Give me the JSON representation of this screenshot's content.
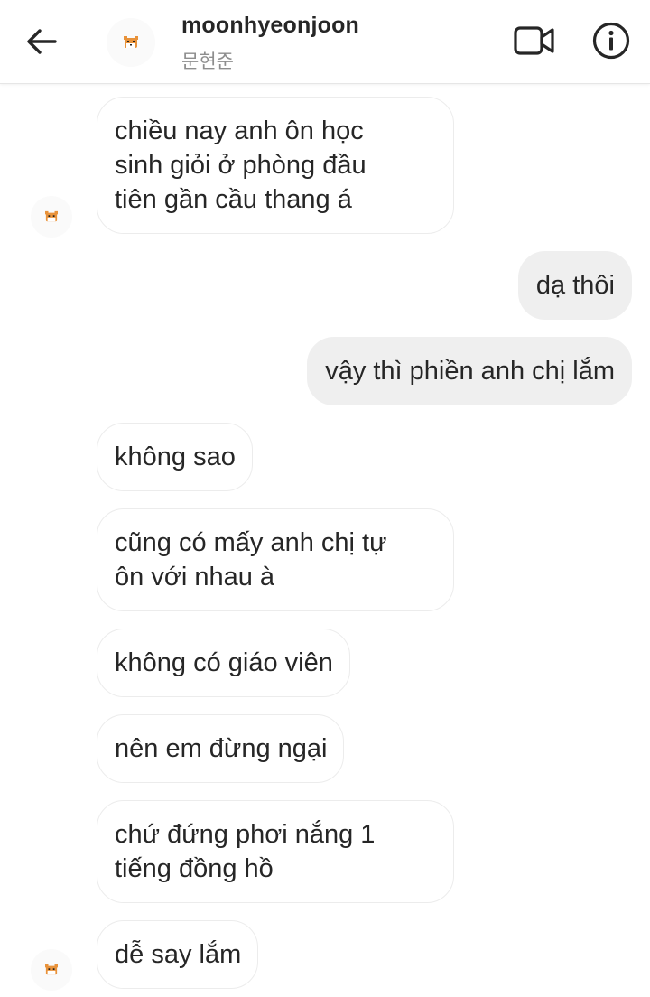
{
  "header": {
    "username": "moonhyeonjoon",
    "subtitle": "문현준",
    "back_icon": "arrow-left-icon",
    "video_icon": "video-camera-icon",
    "info_icon": "info-icon"
  },
  "colors": {
    "incoming_bubble": "#ffffff",
    "incoming_border": "#ececec",
    "outgoing_bubble": "#efefef",
    "text": "#262626",
    "subtitle": "#8e8e8e"
  },
  "messages": [
    {
      "direction": "in",
      "lines": [
        "chiều nay anh ôn học",
        "sinh giỏi ở phòng đầu",
        "tiên gần cầu thang á"
      ]
    },
    {
      "direction": "out",
      "lines": [
        "dạ thôi"
      ]
    },
    {
      "direction": "out",
      "lines": [
        "vậy thì phiền anh chị lắm"
      ]
    },
    {
      "direction": "in",
      "lines": [
        "không sao"
      ]
    },
    {
      "direction": "in",
      "lines": [
        "cũng có mấy anh chị tự",
        "ôn với nhau à"
      ]
    },
    {
      "direction": "in",
      "lines": [
        "không có giáo viên"
      ]
    },
    {
      "direction": "in",
      "lines": [
        "nên em đừng ngại"
      ]
    },
    {
      "direction": "in",
      "lines": [
        "chứ đứng phơi nắng 1",
        "tiếng đồng hồ"
      ]
    },
    {
      "direction": "in",
      "lines": [
        "dễ say lắm"
      ]
    }
  ]
}
